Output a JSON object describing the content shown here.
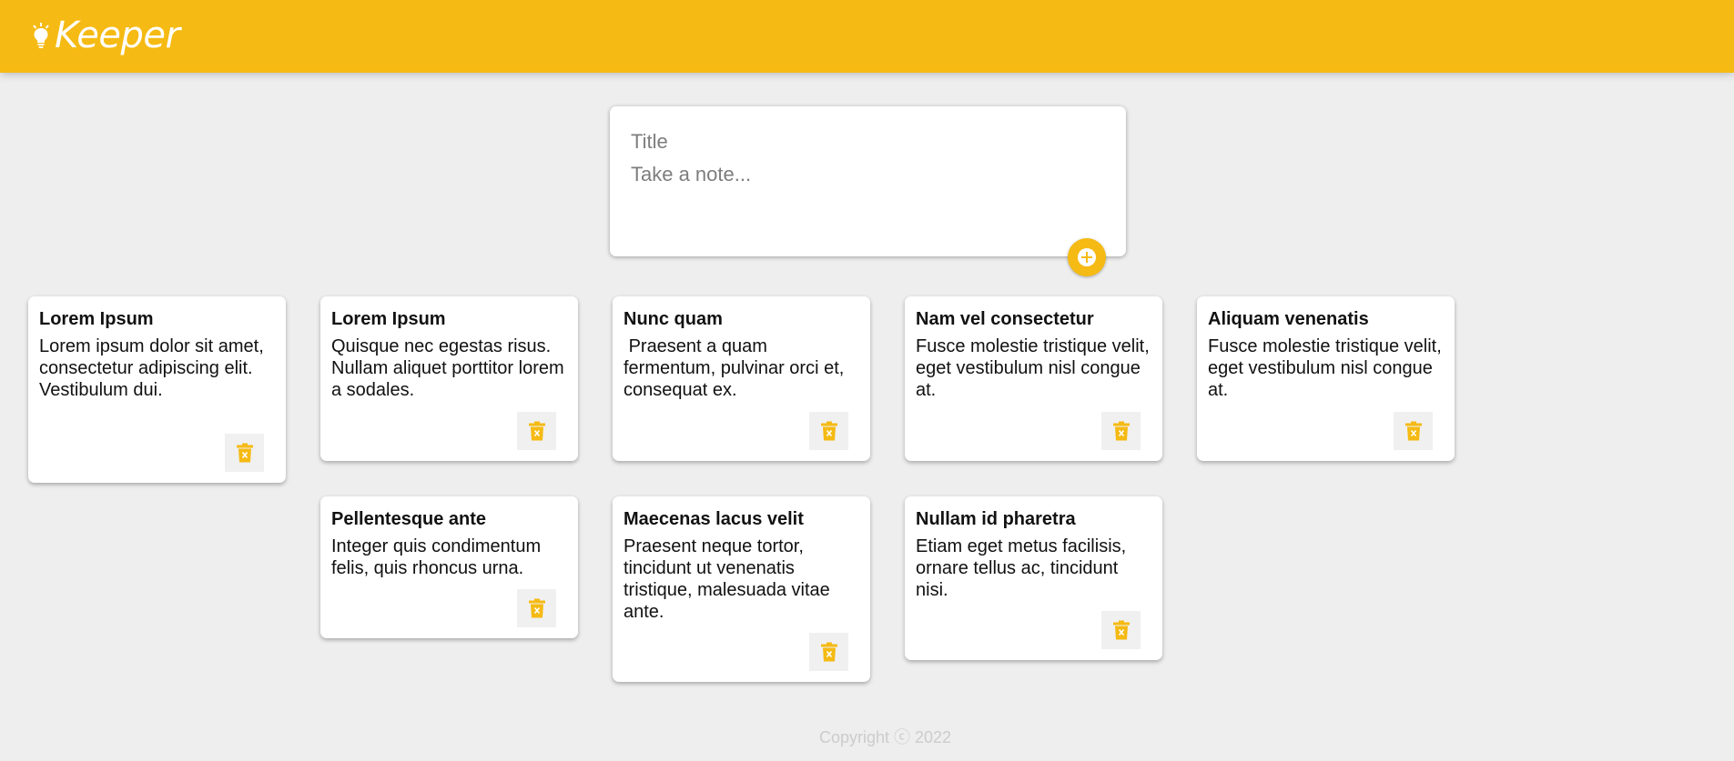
{
  "app": {
    "title": "Keeper",
    "brand_color": "#f5ba13",
    "logo_icon": "lightbulb-icon"
  },
  "create_note": {
    "title_placeholder": "Title",
    "content_placeholder": "Take a note...",
    "add_icon": "plus-circle-icon"
  },
  "notes": [
    {
      "title": "Lorem Ipsum",
      "content": "Lorem ipsum dolor sit amet, consectetur adipiscing elit. Vestibulum dui.",
      "delete_icon": "trash-icon"
    },
    {
      "title": "Lorem Ipsum",
      "content": "Quisque nec egestas risus. Nullam aliquet porttitor lorem a sodales.",
      "delete_icon": "trash-icon"
    },
    {
      "title": "Nunc quam",
      "content": " Praesent a quam fermentum, pulvinar orci et, consequat ex.",
      "delete_icon": "trash-icon"
    },
    {
      "title": "Nam vel consectetur",
      "content": "Fusce molestie tristique velit, eget vestibulum nisl congue at.",
      "delete_icon": "trash-icon"
    },
    {
      "title": "Aliquam venenatis",
      "content": "Fusce molestie tristique velit, eget vestibulum nisl congue at.",
      "delete_icon": "trash-icon"
    },
    {
      "title": "Pellentesque ante",
      "content": "Integer quis condimentum felis, quis rhoncus urna.",
      "delete_icon": "trash-icon"
    },
    {
      "title": "Maecenas lacus velit",
      "content": "Praesent neque tortor, tincidunt ut venenatis tristique, malesuada vitae ante.",
      "delete_icon": "trash-icon"
    },
    {
      "title": "Nullam id pharetra",
      "content": "Etiam eget metus facilisis, ornare tellus ac, tincidunt nisi.",
      "delete_icon": "trash-icon"
    }
  ],
  "footer": {
    "text": "Copyright ⓒ 2022"
  }
}
